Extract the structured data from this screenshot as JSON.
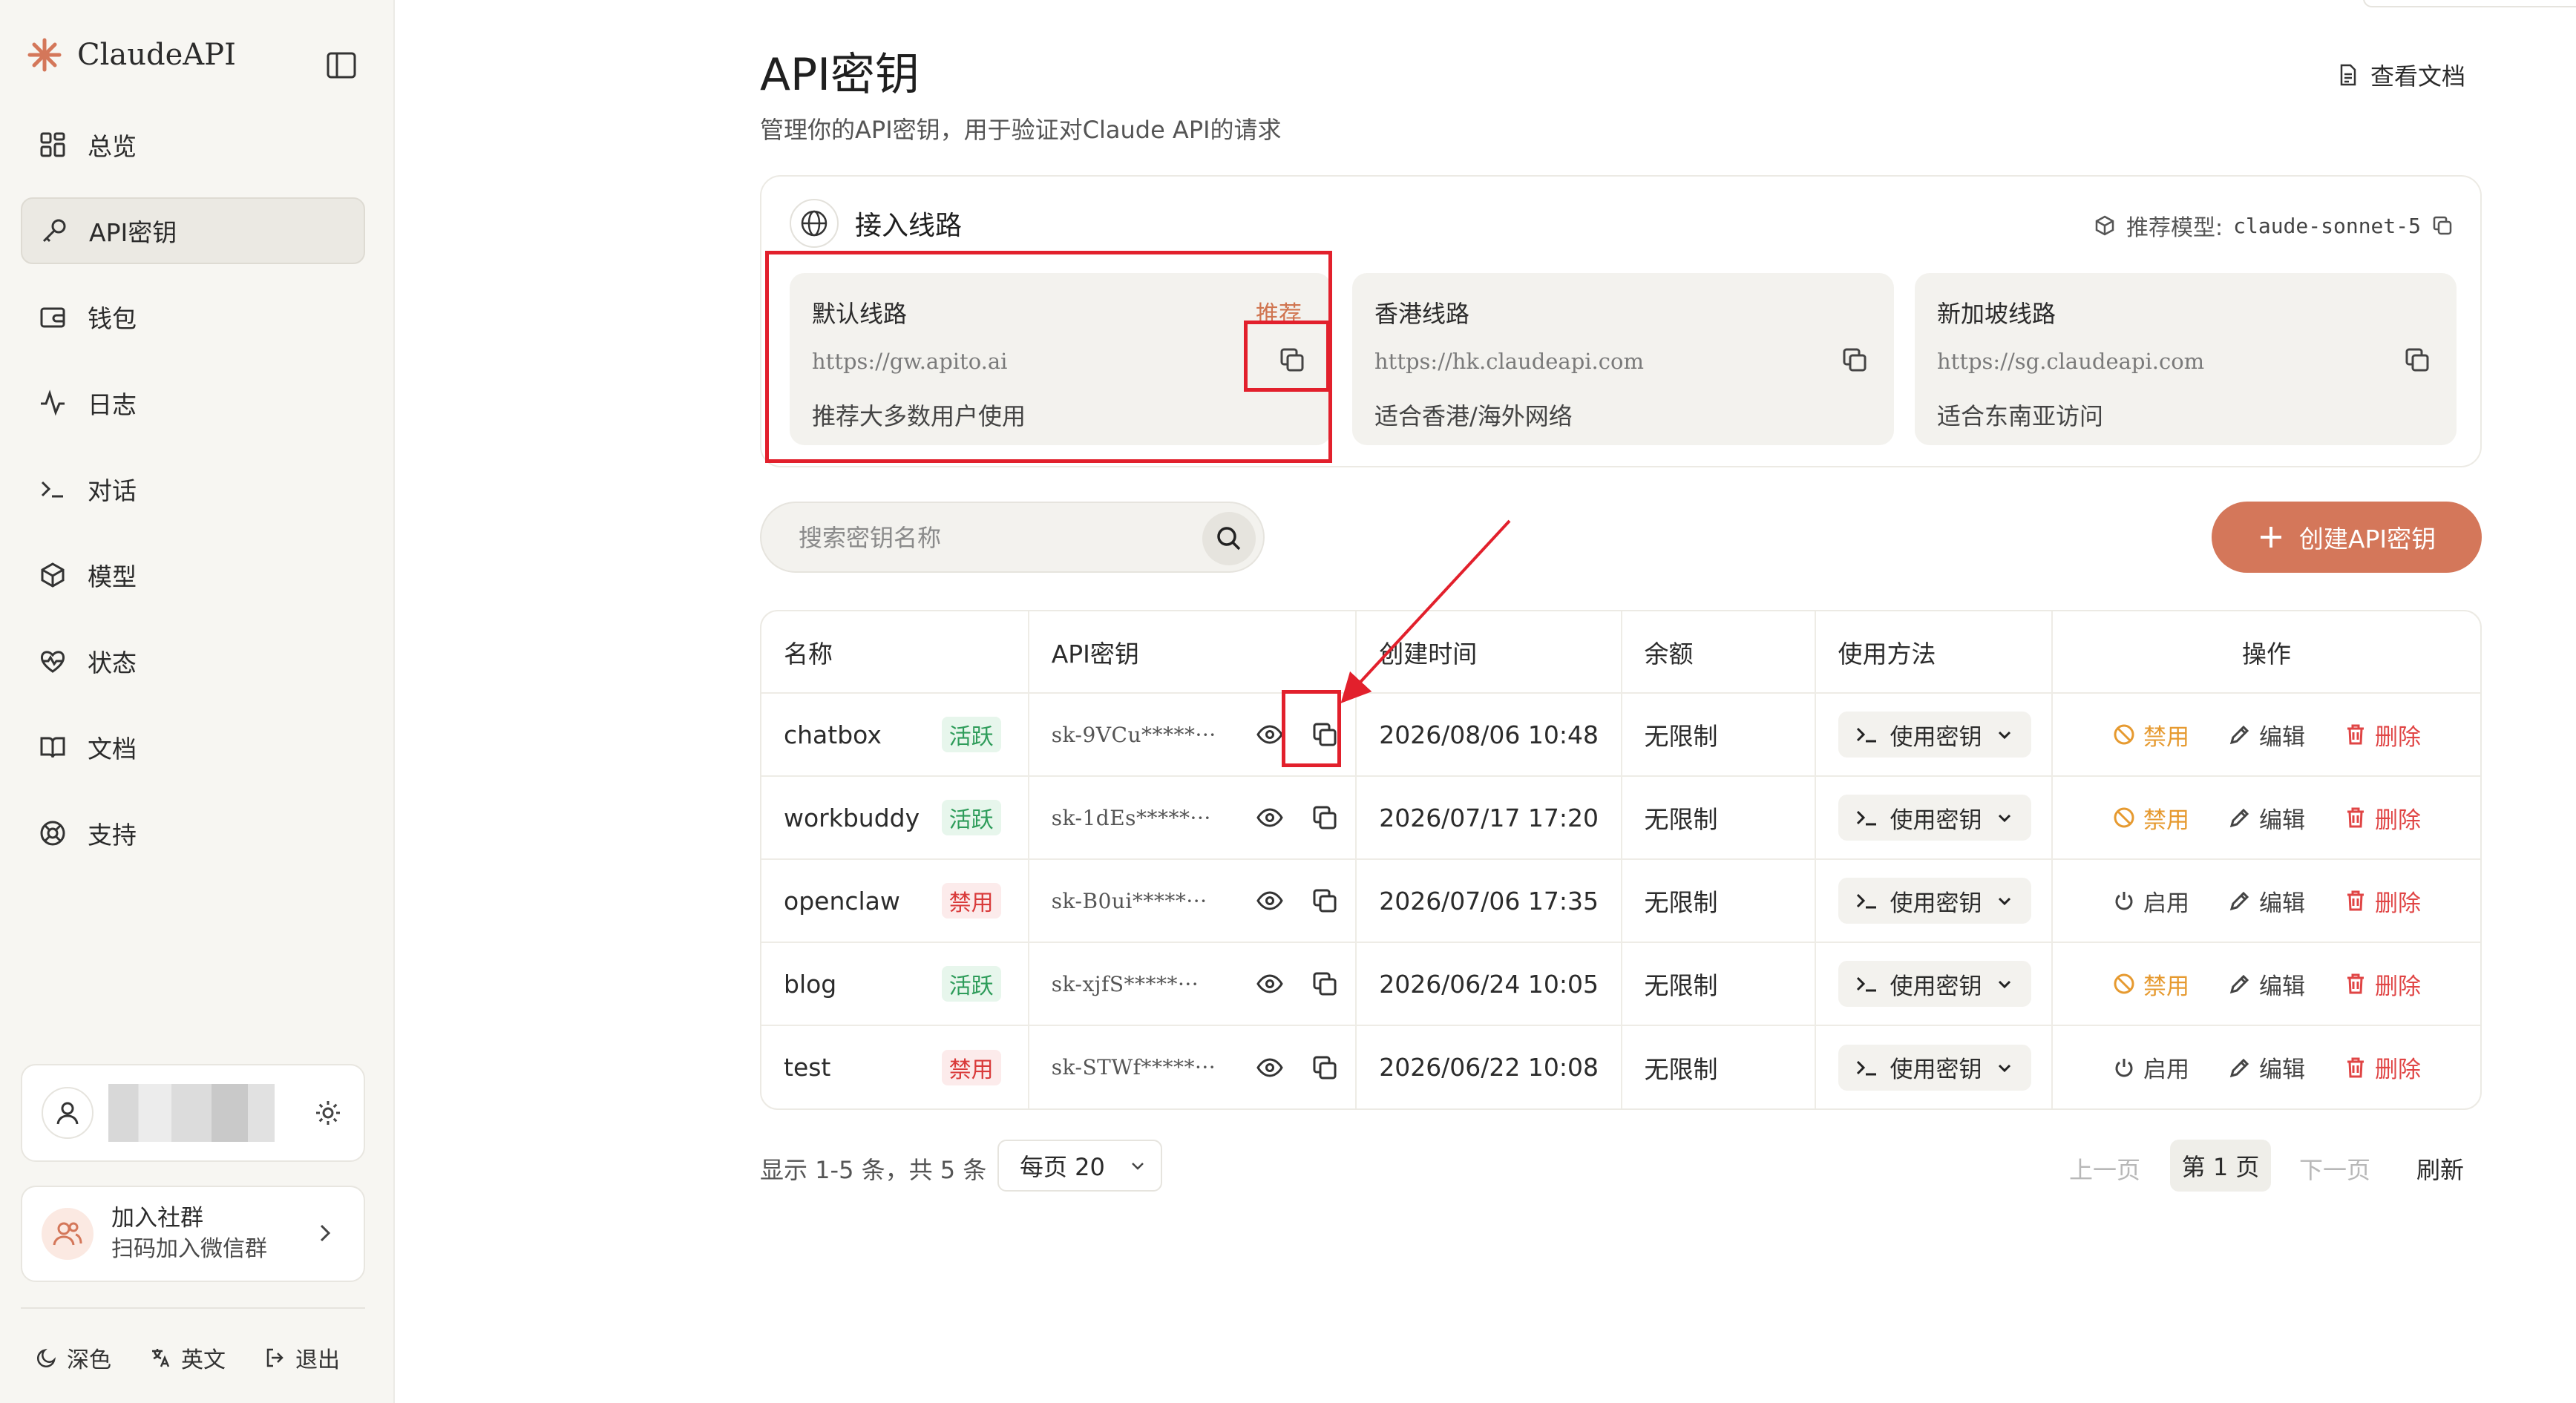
{
  "app": {
    "logo_text": "ClaudeAPI"
  },
  "sidebar": {
    "items": [
      {
        "label": "总览",
        "icon": "dashboard-icon"
      },
      {
        "label": "API密钥",
        "icon": "key-icon",
        "active": true
      },
      {
        "label": "钱包",
        "icon": "wallet-icon"
      },
      {
        "label": "日志",
        "icon": "activity-icon"
      },
      {
        "label": "对话",
        "icon": "terminal-icon"
      },
      {
        "label": "模型",
        "icon": "cube-icon"
      },
      {
        "label": "状态",
        "icon": "heart-pulse-icon"
      },
      {
        "label": "文档",
        "icon": "book-icon"
      },
      {
        "label": "支持",
        "icon": "lifebuoy-icon"
      }
    ],
    "community": {
      "title": "加入社群",
      "subtitle": "扫码加入微信群"
    },
    "footer": {
      "theme": "深色",
      "language": "英文",
      "logout": "退出"
    }
  },
  "page": {
    "title": "API密钥",
    "subtitle": "管理你的API密钥，用于验证对Claude API的请求",
    "docs_label": "查看文档"
  },
  "routes": {
    "title": "接入线路",
    "recommend_label": "推荐模型:",
    "recommend_model": "claude-sonnet-5",
    "items": [
      {
        "name": "默认线路",
        "badge": "推荐",
        "url": "https://gw.apito.ai",
        "desc": "推荐大多数用户使用"
      },
      {
        "name": "香港线路",
        "badge": "",
        "url": "https://hk.claudeapi.com",
        "desc": "适合香港/海外网络"
      },
      {
        "name": "新加坡线路",
        "badge": "",
        "url": "https://sg.claudeapi.com",
        "desc": "适合东南亚访问"
      }
    ]
  },
  "search": {
    "placeholder": "搜索密钥名称"
  },
  "create_label": "创建API密钥",
  "table": {
    "headers": {
      "name": "名称",
      "key": "API密钥",
      "created": "创建时间",
      "balance": "余额",
      "usage": "使用方法",
      "actions": "操作"
    },
    "usage_label": "使用密钥",
    "edit_label": "编辑",
    "delete_label": "删除",
    "rows": [
      {
        "name": "chatbox",
        "status": "活跃",
        "key": "sk-9VCu*****···",
        "created": "2026/08/06 10:48",
        "balance": "无限制",
        "toggle": "禁用"
      },
      {
        "name": "workbuddy",
        "status": "活跃",
        "key": "sk-1dEs*****···",
        "created": "2026/07/17 17:20",
        "balance": "无限制",
        "toggle": "禁用"
      },
      {
        "name": "openclaw",
        "status": "禁用",
        "key": "sk-B0ui*****···",
        "created": "2026/07/06 17:35",
        "balance": "无限制",
        "toggle": "启用"
      },
      {
        "name": "blog",
        "status": "活跃",
        "key": "sk-xjfS*****···",
        "created": "2026/06/24 10:05",
        "balance": "无限制",
        "toggle": "禁用"
      },
      {
        "name": "test",
        "status": "禁用",
        "key": "sk-STWf*****···",
        "created": "2026/06/22 10:08",
        "balance": "无限制",
        "toggle": "启用"
      }
    ]
  },
  "pagination": {
    "info": "显示 1-5 条，共 5 条",
    "page_size": "每页 20",
    "prev": "上一页",
    "current": "第 1 页",
    "next": "下一页",
    "refresh": "刷新"
  },
  "colors": {
    "accent": "#d4775a",
    "highlight": "#e2202c",
    "active": "#2e9c5a",
    "banned": "#d93a3a",
    "warn": "#e69a30"
  }
}
